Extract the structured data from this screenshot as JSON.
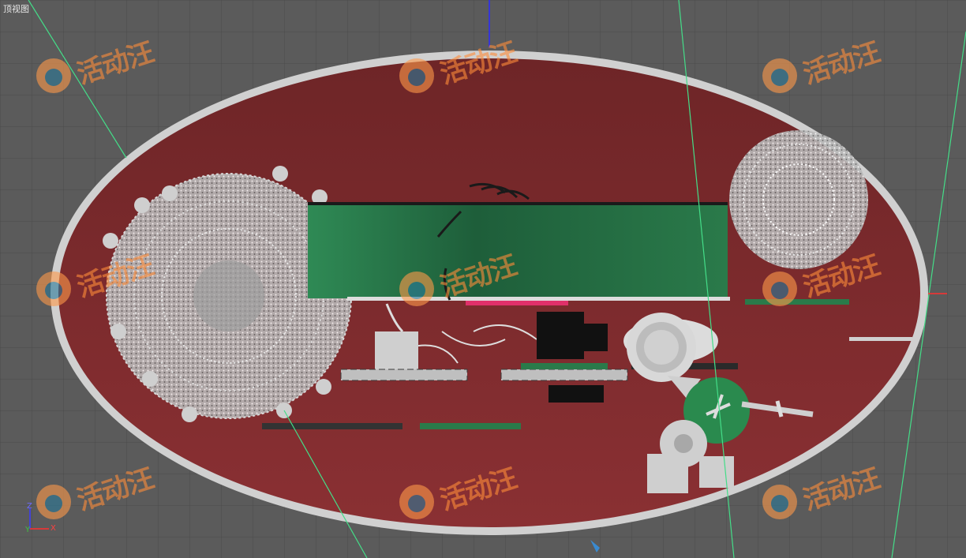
{
  "viewport": {
    "view_name": "顶视图",
    "colors": {
      "background": "#5b5b5b",
      "grid": "#4a4a4a",
      "floor": "#7a2b2d",
      "floor_rim": "#cfcfcf",
      "wall_panel": "#2a7a4a",
      "accent_pink": "#e0306a",
      "axis_y": "#2a2aff",
      "axis_x": "#ff3030",
      "guide": "#44dd88"
    }
  },
  "axis_gizmo": {
    "y_label": "Z",
    "x_label": "X",
    "origin_label": "Y"
  },
  "watermark": {
    "text": "活动汪"
  }
}
